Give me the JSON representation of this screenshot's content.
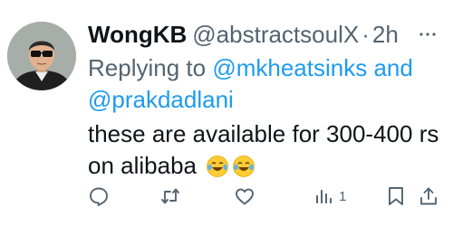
{
  "tweet": {
    "author_name": "WongKB",
    "author_handle": "@abstractsoulX",
    "separator": "·",
    "time": "2h",
    "reply_prefix": "Replying to ",
    "reply_mention_1": "@mkheatsinks",
    "reply_and": " and",
    "reply_mention_2": "@prakdadlani",
    "text_line1": "these are available for 300-400 rs",
    "text_line2": "on alibaba",
    "emojis": [
      "face-with-tears-of-joy",
      "face-with-tears-of-joy"
    ]
  },
  "actions": {
    "views_count": "1"
  },
  "icons": {
    "more": "more-options-icon",
    "reply": "reply-icon",
    "retweet": "retweet-icon",
    "like": "like-icon",
    "views": "views-icon",
    "bookmark": "bookmark-icon",
    "share": "share-icon"
  },
  "colors": {
    "text": "#0f1419",
    "secondary": "#536471",
    "link": "#1d9bf0",
    "background": "#ffffff"
  }
}
